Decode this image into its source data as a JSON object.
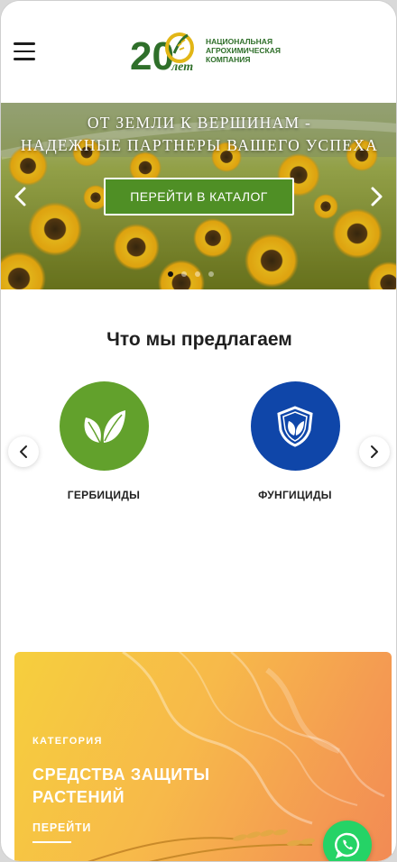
{
  "header": {
    "logo_number": "20",
    "logo_years": "лет",
    "logo_text": [
      "НАЦИОНАЛЬНАЯ",
      "АГРОХИМИЧЕСКАЯ",
      "КОМПАНИЯ"
    ],
    "icons": {
      "menu": "hamburger-icon"
    }
  },
  "banner": {
    "title_line1": "ОТ ЗЕМЛИ К ВЕРШИНАМ -",
    "title_line2": "НАДЕЖНЫЕ ПАРТНЕРЫ ВАШЕГО УСПЕХА",
    "button_label": "ПЕРЕЙТИ В КАТАЛОГ",
    "slide_count": 4,
    "active_slide": 1
  },
  "offers": {
    "title": "Что мы предлагаем",
    "items": [
      {
        "label": "ГЕРБИЦИДЫ",
        "icon": "leaves-icon",
        "color": "#62a12c"
      },
      {
        "label": "ФУНГИЦИДЫ",
        "icon": "shield-leaf-icon",
        "color": "#0f46a9"
      }
    ]
  },
  "category_card": {
    "kicker": "КАТЕГОРИЯ",
    "title": "СРЕДСТВА ЗАЩИТЫ РАСТЕНИЙ",
    "link": "ПЕРЕЙТИ"
  },
  "colors": {
    "brand_green": "#2f6f2a",
    "button_green": "#4f8f25",
    "whatsapp": "#25d366"
  }
}
